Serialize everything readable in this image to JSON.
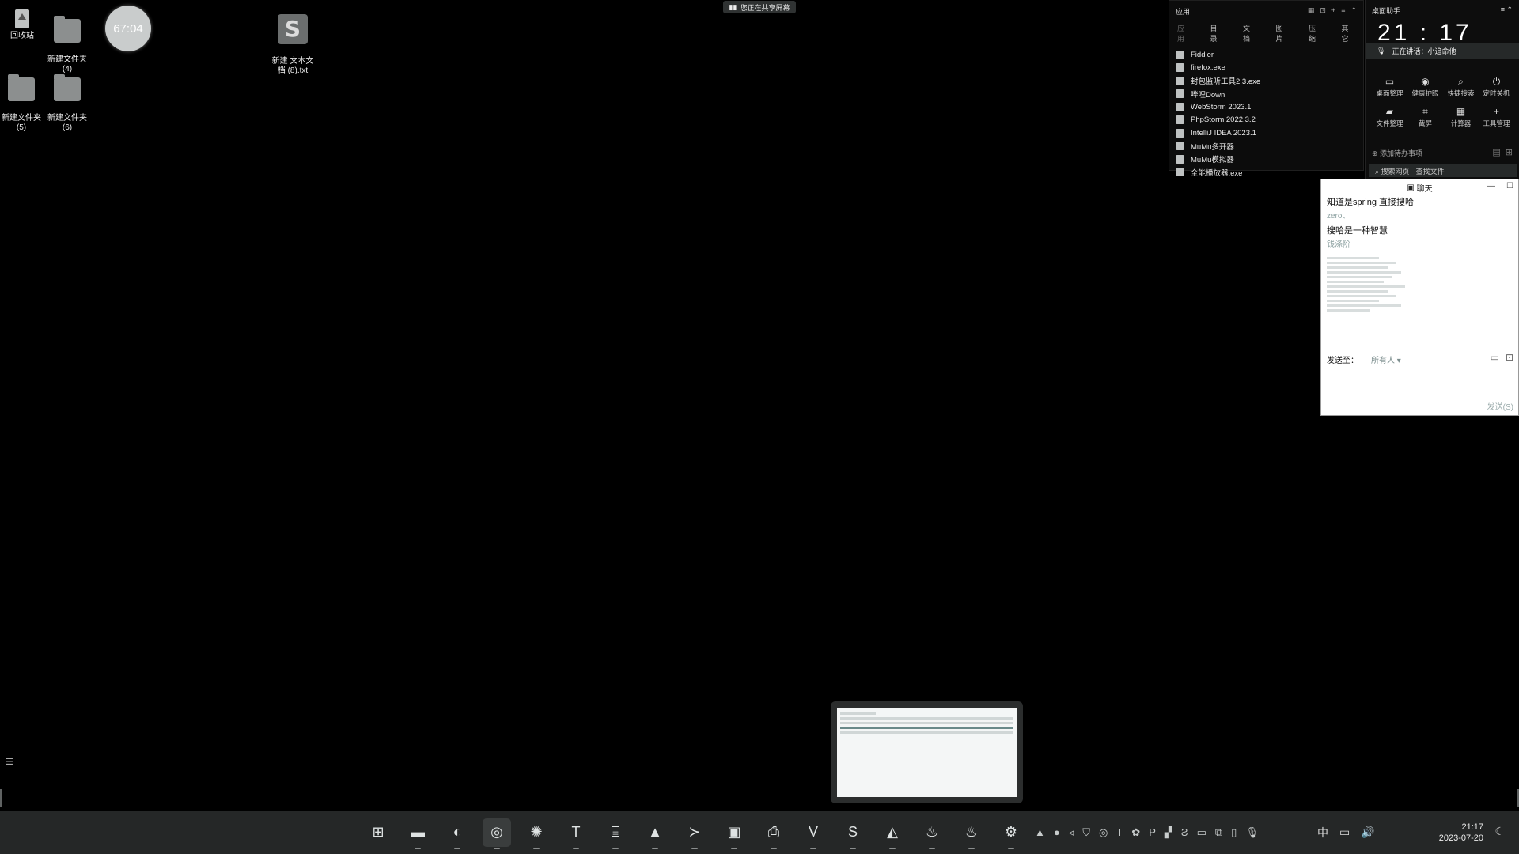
{
  "desktop": {
    "icons": [
      {
        "label": "回收站"
      },
      {
        "label": "新建文件夹\n(4)"
      },
      {
        "label": "新建文件夹\n(5)"
      },
      {
        "label": "新建文件夹\n(6)"
      },
      {
        "label": "新建 文本文\n档 (8).txt"
      }
    ],
    "timer_bubble": "67:04",
    "share_banner": "您正在共享屏幕"
  },
  "apps_panel": {
    "title": "应用",
    "tabs": [
      "应用",
      "目录",
      "文档",
      "图片",
      "压缩",
      "其它"
    ],
    "items": [
      "Fiddler",
      "firefox.exe",
      "封包监听工具2.3.exe",
      "哔哩Down",
      "WebStorm 2023.1",
      "PhpStorm 2022.3.2",
      "IntelliJ IDEA 2023.1",
      "MuMu多开器",
      "MuMu模拟器",
      "全能播放器.exe"
    ]
  },
  "assistant": {
    "title": "桌面助手",
    "time": "21 : 17",
    "voice_status": "正在讲话：小追命他",
    "tools_row1": [
      "桌面整理",
      "健康护眼",
      "快捷搜索",
      "定时关机"
    ],
    "tools_row2": [
      "文件整理",
      "截屏",
      "计算器",
      "工具管理"
    ],
    "todo": "添加待办事项",
    "search_tabs": [
      "搜索网页",
      "查找文件"
    ]
  },
  "chat": {
    "title": "聊天",
    "messages": [
      {
        "kind": "text",
        "value": "知道是spring 直接搜哈"
      },
      {
        "kind": "sender",
        "value": "zero、"
      },
      {
        "kind": "text",
        "value": "搜哈是一种智慧"
      },
      {
        "kind": "sender",
        "value": "钱涤阶"
      }
    ],
    "send_to_label": "发送至：",
    "recipient": "所有人 ▾",
    "send_button": "发送(S)"
  },
  "taskbar": {
    "apps": [
      "start",
      "file-explorer",
      "edge",
      "chrome",
      "browser",
      "typora",
      "remote",
      "photos",
      "terminal",
      "jetbrains",
      "printer",
      "vim",
      "sublime",
      "inkscape",
      "java",
      "java",
      "settings"
    ],
    "input_method": "中",
    "time": "21:17",
    "date": "2023-07-20"
  }
}
